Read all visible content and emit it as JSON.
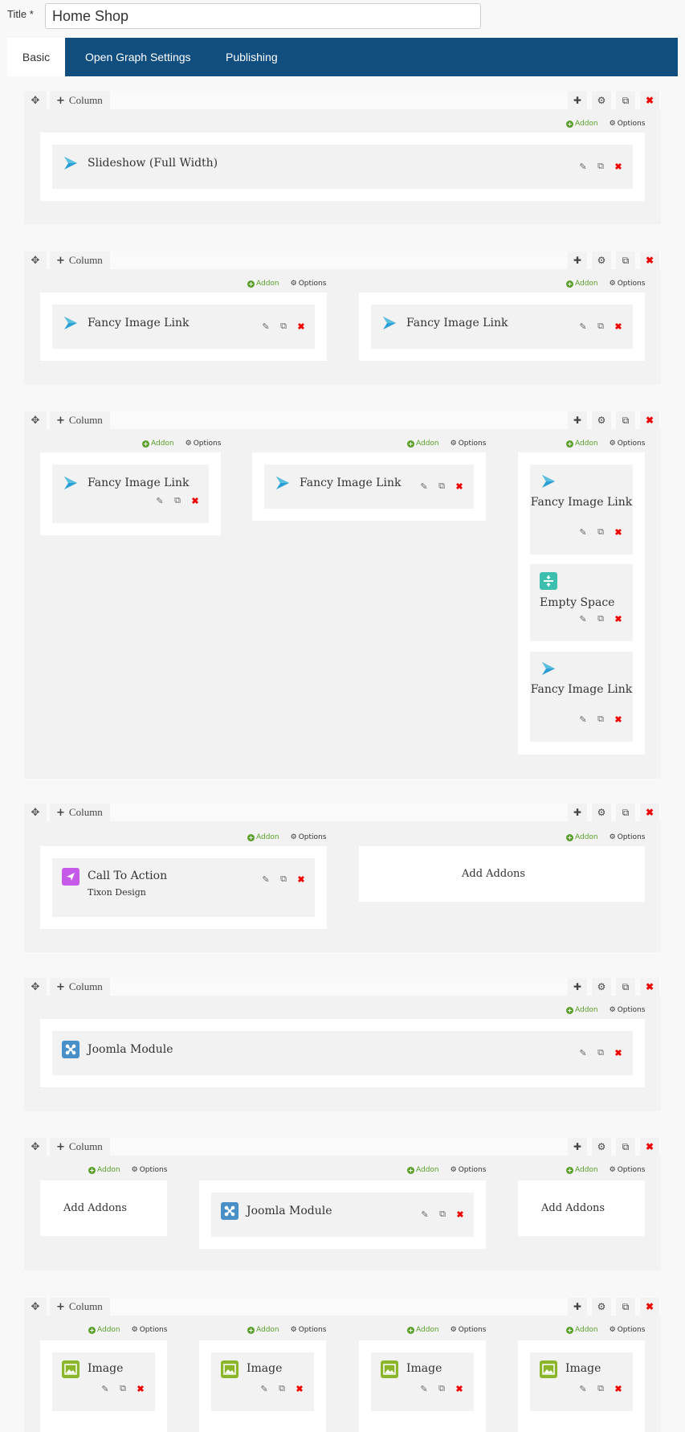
{
  "title": {
    "label": "Title *",
    "value": "Home Shop"
  },
  "tabs": [
    {
      "label": "Basic"
    },
    {
      "label": "Open Graph Settings"
    },
    {
      "label": "Publishing"
    }
  ],
  "row_labels": {
    "column": "Column",
    "addon": "Addon",
    "options": "Options"
  },
  "addons": {
    "slideshow": "Slideshow (Full Width)",
    "fancy": "Fancy Image Link",
    "empty": "Empty Space",
    "cta": "Call To Action",
    "cta_sub": "Tixon Design",
    "joomla": "Joomla Module",
    "image": "Image",
    "add_addons": "Add Addons"
  },
  "icons": {
    "move": "move-icon",
    "add": "plus-icon",
    "settings": "gear-icon",
    "copy": "copy-icon",
    "delete": "close-icon",
    "edit": "pencil-icon"
  },
  "colors": {
    "tab_bar": "#114e80",
    "delete": "#e00000",
    "addon_green": "#5a9f2a"
  }
}
